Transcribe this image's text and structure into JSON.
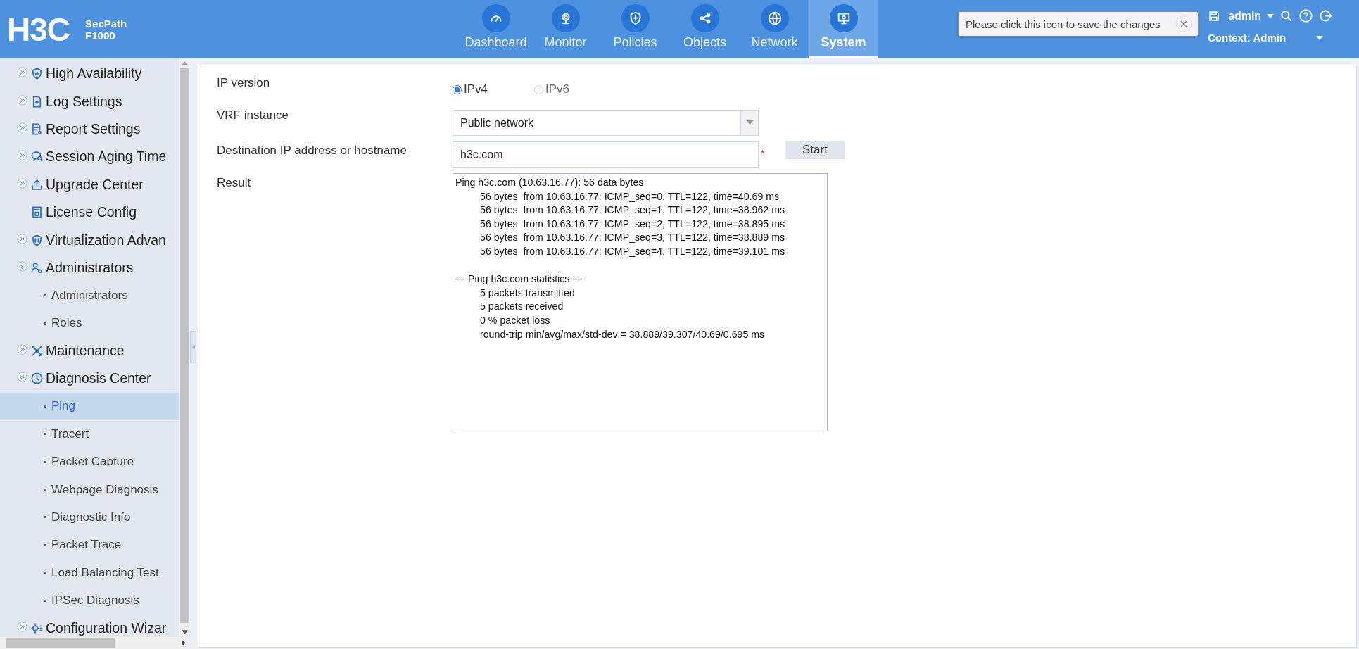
{
  "header": {
    "logo": "H3C",
    "product": "SecPath",
    "model": "F1000",
    "nav": [
      {
        "label": "Dashboard",
        "selected": false
      },
      {
        "label": "Monitor",
        "selected": false
      },
      {
        "label": "Policies",
        "selected": false
      },
      {
        "label": "Objects",
        "selected": false
      },
      {
        "label": "Network",
        "selected": false
      },
      {
        "label": "System",
        "selected": true
      }
    ],
    "tooltip": "Please click this icon to save the changes",
    "user": "admin",
    "context": "Context: Admin"
  },
  "sidebar": {
    "items": [
      {
        "label": "High Availability",
        "kind": "group",
        "expanded": false,
        "selected": false
      },
      {
        "label": "Log Settings",
        "kind": "group",
        "expanded": false,
        "selected": false
      },
      {
        "label": "Report Settings",
        "kind": "group",
        "expanded": false,
        "selected": false
      },
      {
        "label": "Session Aging Time",
        "kind": "group",
        "expanded": false,
        "selected": false
      },
      {
        "label": "Upgrade Center",
        "kind": "group",
        "expanded": false,
        "selected": false
      },
      {
        "label": "License Config",
        "kind": "leaf",
        "selected": false
      },
      {
        "label": "Virtualization Advan",
        "kind": "group",
        "expanded": false,
        "selected": false
      },
      {
        "label": "Administrators",
        "kind": "group",
        "expanded": true,
        "selected": false,
        "children": [
          {
            "label": "Administrators",
            "selected": false
          },
          {
            "label": "Roles",
            "selected": false
          }
        ]
      },
      {
        "label": "Maintenance",
        "kind": "group",
        "expanded": false,
        "selected": false
      },
      {
        "label": "Diagnosis Center",
        "kind": "group",
        "expanded": true,
        "selected": false,
        "children": [
          {
            "label": "Ping",
            "selected": true
          },
          {
            "label": "Tracert",
            "selected": false
          },
          {
            "label": "Packet Capture",
            "selected": false
          },
          {
            "label": "Webpage Diagnosis",
            "selected": false
          },
          {
            "label": "Diagnostic Info",
            "selected": false
          },
          {
            "label": "Packet Trace",
            "selected": false
          },
          {
            "label": "Load Balancing Test",
            "selected": false
          },
          {
            "label": "IPSec Diagnosis",
            "selected": false
          }
        ]
      },
      {
        "label": "Configuration Wizar",
        "kind": "group",
        "expanded": false,
        "selected": false
      }
    ]
  },
  "form": {
    "ip_version": {
      "label": "IP version",
      "options": [
        {
          "label": "IPv4",
          "selected": true
        },
        {
          "label": "IPv6",
          "selected": false
        }
      ]
    },
    "vrf": {
      "label": "VRF instance",
      "value": "Public network"
    },
    "destination": {
      "label": "Destination IP address or hostname",
      "value": "h3c.com",
      "required_mark": "*"
    },
    "start_button": "Start",
    "result": {
      "label": "Result",
      "blocks": [
        {
          "heading": "Ping h3c.com (10.63.16.77): 56 data bytes",
          "lines": [
            "56 bytes  from 10.63.16.77: ICMP_seq=0, TTL=122, time=40.69 ms",
            "56 bytes  from 10.63.16.77: ICMP_seq=1, TTL=122, time=38.962 ms",
            "56 bytes  from 10.63.16.77: ICMP_seq=2, TTL=122, time=38.895 ms",
            "56 bytes  from 10.63.16.77: ICMP_seq=3, TTL=122, time=38.889 ms",
            "56 bytes  from 10.63.16.77: ICMP_seq=4, TTL=122, time=39.101 ms"
          ]
        },
        {
          "heading": "--- Ping h3c.com statistics ---",
          "lines": [
            "5 packets transmitted",
            "5 packets received",
            "0 % packet loss",
            "round-trip min/avg/max/std-dev = 38.889/39.307/40.69/0.695 ms"
          ]
        }
      ]
    }
  }
}
